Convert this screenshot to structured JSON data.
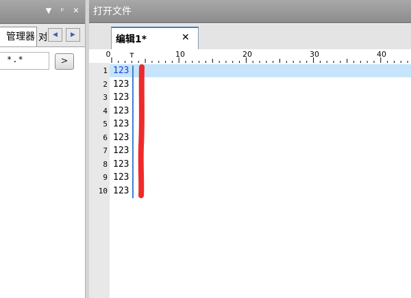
{
  "left_panel": {
    "title_buttons": {
      "dropdown": "▼",
      "pin": "ᵖ",
      "close": "✕"
    },
    "tabs": [
      {
        "label": "管理器",
        "active": true
      },
      {
        "label": "对",
        "active": false
      }
    ],
    "nav_prev": "◀",
    "nav_next": "▶",
    "filter": {
      "value": "*.*"
    },
    "go_label": ">"
  },
  "editor": {
    "window_title": "打开文件",
    "tab": {
      "label": "编辑1*",
      "close": "✕"
    },
    "ruler_labels": [
      "0",
      "10",
      "20",
      "30",
      "40"
    ],
    "current_line_number": 1,
    "caret_column": 3,
    "line_numbers": [
      "1",
      "2",
      "3",
      "4",
      "5",
      "6",
      "7",
      "8",
      "9",
      "10"
    ],
    "lines": [
      "123",
      "123",
      "123",
      "123",
      "123",
      "123",
      "123",
      "123",
      "123",
      "123"
    ],
    "colors": {
      "title_bar": "#9a9a9a",
      "current_line_highlight": "#c6e4fb",
      "active_line_text": "#1a3fd6",
      "caret_bar": "#3d7fd3",
      "annotation_stroke": "#ee2a2a",
      "active_tab_border": "#3c7fcf"
    }
  }
}
